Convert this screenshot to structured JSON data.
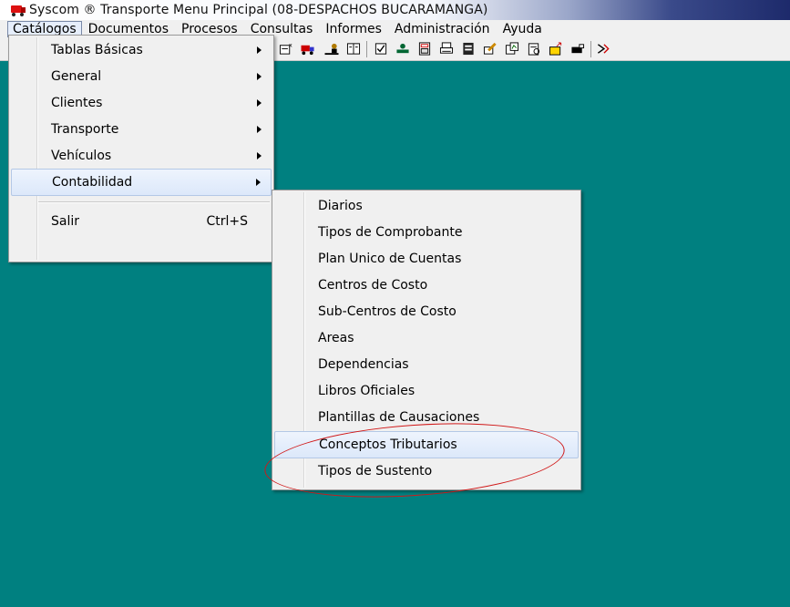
{
  "window": {
    "title": "Syscom ® Transporte Menu Principal (08-DESPACHOS BUCARAMANGA)",
    "icon": "truck-icon"
  },
  "menubar": {
    "items": [
      "Catálogos",
      "Documentos",
      "Procesos",
      "Consultas",
      "Informes",
      "Administración",
      "Ayuda"
    ]
  },
  "toolbar": {
    "icons": [
      "document-icon",
      "list-icon",
      "truck-icon",
      "user-icon",
      "book-icon",
      "check-icon",
      "road-icon",
      "calculator-icon",
      "printer-icon",
      "calendar-icon",
      "pencil-icon",
      "chart-icon",
      "report-icon",
      "folder-icon",
      "key-icon",
      "exit-icon"
    ]
  },
  "catalogos_menu": {
    "items": [
      {
        "label": "Tablas Básicas"
      },
      {
        "label": "General"
      },
      {
        "label": "Clientes"
      },
      {
        "label": "Transporte"
      },
      {
        "label": "Vehículos"
      },
      {
        "label": "Contabilidad"
      }
    ],
    "exit": {
      "label": "Salir",
      "shortcut": "Ctrl+S"
    }
  },
  "contabilidad_menu": {
    "items": [
      {
        "label": "Diarios"
      },
      {
        "label": "Tipos de Comprobante"
      },
      {
        "label": "Plan Unico de Cuentas"
      },
      {
        "label": "Centros de Costo"
      },
      {
        "label": "Sub-Centros de Costo"
      },
      {
        "label": "Areas"
      },
      {
        "label": "Dependencias"
      },
      {
        "label": "Libros Oficiales"
      },
      {
        "label": "Plantillas de Causaciones"
      },
      {
        "label": "Conceptos Tributarios"
      },
      {
        "label": "Tipos de Sustento"
      }
    ]
  },
  "colors": {
    "desktop": "#008080",
    "annotation": "#d01818"
  }
}
